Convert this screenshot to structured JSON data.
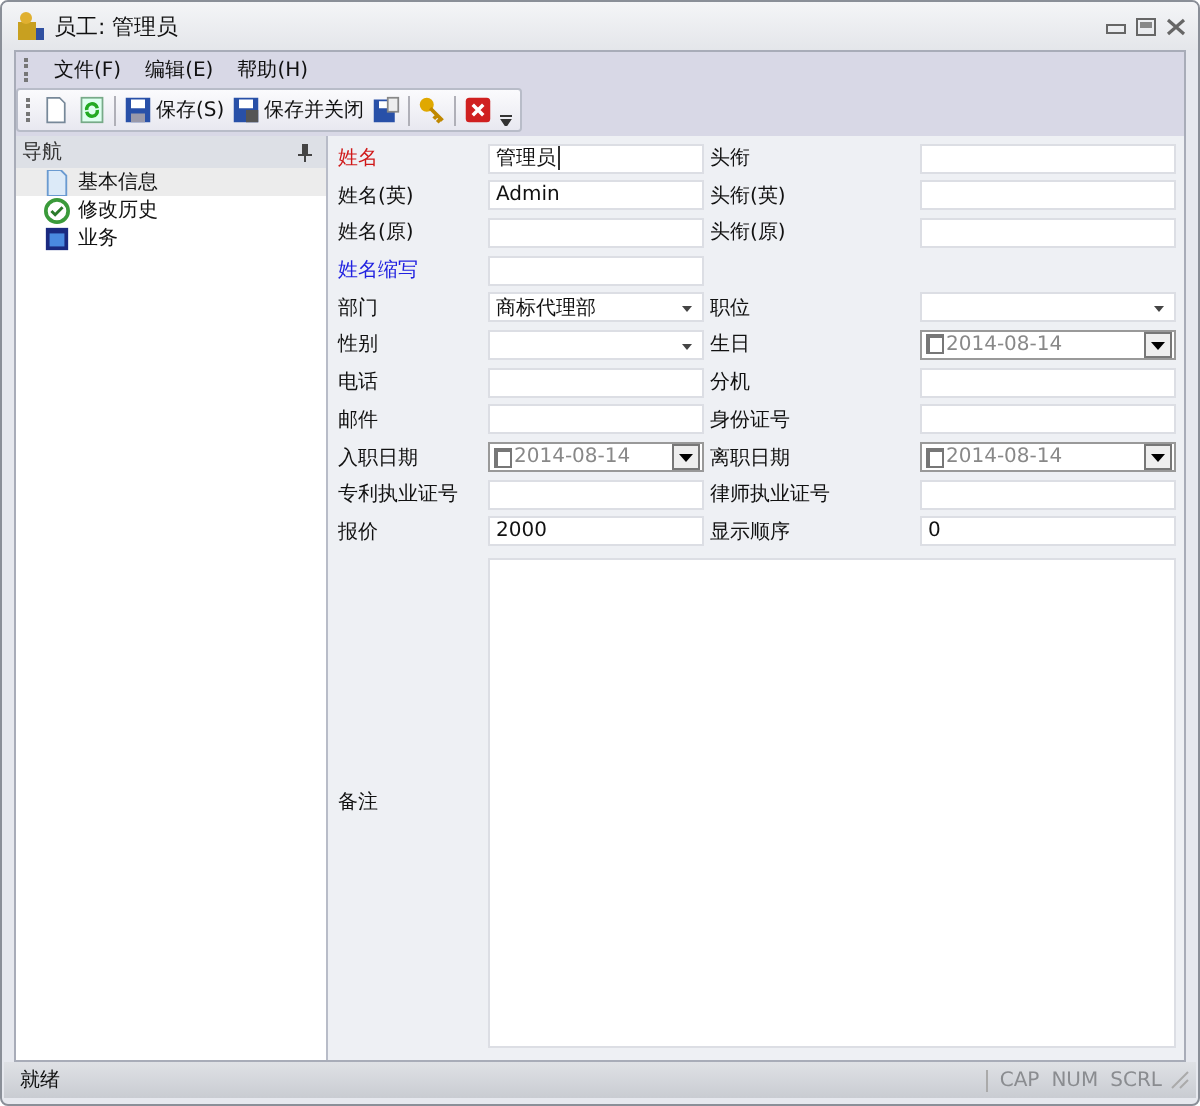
{
  "window": {
    "title": "员工: 管理员"
  },
  "menu": [
    {
      "label": "文件(F)"
    },
    {
      "label": "编辑(E)"
    },
    {
      "label": "帮助(H)"
    }
  ],
  "toolbar": [
    {
      "kind": "new"
    },
    {
      "kind": "refresh"
    },
    {
      "kind": "sep"
    },
    {
      "kind": "save",
      "label": "保存(S)"
    },
    {
      "kind": "saveclose",
      "label": "保存并关闭"
    },
    {
      "kind": "saveas"
    },
    {
      "kind": "sep"
    },
    {
      "kind": "key"
    },
    {
      "kind": "sep"
    },
    {
      "kind": "delete"
    }
  ],
  "nav": {
    "title": "导航",
    "items": [
      {
        "label": "基本信息",
        "selected": true
      },
      {
        "label": "修改历史",
        "selected": false
      },
      {
        "label": "业务",
        "selected": false
      }
    ]
  },
  "form": {
    "rows": [
      [
        {
          "label": "姓名",
          "color": "#d01818",
          "kind": "text",
          "value": "管理员"
        },
        {
          "label": "头衔",
          "kind": "text"
        }
      ],
      [
        {
          "label": "姓名(英)",
          "kind": "text",
          "value": "Admin"
        },
        {
          "label": "头衔(英)",
          "kind": "text"
        }
      ],
      [
        {
          "label": "姓名(原)",
          "kind": "text"
        },
        {
          "label": "头衔(原)",
          "kind": "text"
        }
      ],
      [
        {
          "label": "姓名缩写",
          "color": "#2020e0",
          "kind": "text"
        }
      ],
      [
        {
          "label": "部门",
          "kind": "select",
          "value": "商标代理部"
        },
        {
          "label": "职位",
          "kind": "select"
        }
      ],
      [
        {
          "label": "性别",
          "kind": "select"
        },
        {
          "label": "生日",
          "kind": "date",
          "value": "2014-08-14",
          "checked": false
        }
      ],
      [
        {
          "label": "电话",
          "kind": "text"
        },
        {
          "label": "分机",
          "kind": "text"
        }
      ],
      [
        {
          "label": "邮件",
          "kind": "text"
        },
        {
          "label": "身份证号",
          "kind": "text"
        }
      ],
      [
        {
          "label": "入职日期",
          "kind": "date",
          "value": "2014-08-14",
          "checked": false
        },
        {
          "label": "离职日期",
          "kind": "date",
          "value": "2014-08-14",
          "checked": false
        }
      ],
      [
        {
          "label": "专利执业证号",
          "kind": "text"
        },
        {
          "label": "律师执业证号",
          "kind": "text"
        }
      ],
      [
        {
          "label": "报价",
          "kind": "text",
          "value": "2000"
        },
        {
          "label": "显示顺序",
          "kind": "text",
          "value": "0"
        }
      ]
    ],
    "memo": {
      "label": "备注"
    }
  },
  "status": {
    "text": "就绪",
    "indicators": [
      {
        "label": "CAP",
        "active": false
      },
      {
        "label": "NUM",
        "active": false
      },
      {
        "label": "SCRL",
        "active": false
      }
    ]
  }
}
